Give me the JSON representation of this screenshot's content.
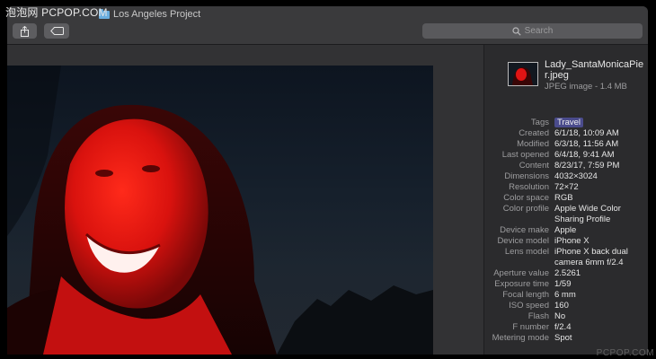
{
  "watermark": "泡泡网 PCPOP.COM",
  "window": {
    "title": "Los Angeles Project"
  },
  "toolbar": {
    "share_icon": "share-icon",
    "tag_icon": "tag-icon"
  },
  "search": {
    "placeholder": "Search",
    "icon": "magnifier-icon"
  },
  "file": {
    "name": "Lady_SantaMonicaPier.jpeg",
    "kind": "JPEG image - 1.4 MB"
  },
  "info": {
    "tags": {
      "label": "Tags",
      "value": "Travel",
      "color": "#4a4b8c"
    },
    "created": {
      "label": "Created",
      "value": "6/1/18, 10:09 AM"
    },
    "modified": {
      "label": "Modified",
      "value": "6/3/18, 11:56 AM"
    },
    "last_opened": {
      "label": "Last opened",
      "value": "6/4/18, 9:41 AM"
    },
    "content": {
      "label": "Content",
      "value": "8/23/17, 7:59 PM"
    },
    "dimensions": {
      "label": "Dimensions",
      "value": "4032×3024"
    },
    "resolution": {
      "label": "Resolution",
      "value": "72×72"
    },
    "color_space": {
      "label": "Color space",
      "value": "RGB"
    },
    "color_profile": {
      "label": "Color profile",
      "value": "Apple Wide Color Sharing Profile"
    },
    "device_make": {
      "label": "Device make",
      "value": "Apple"
    },
    "device_model": {
      "label": "Device model",
      "value": "iPhone X"
    },
    "lens_model": {
      "label": "Lens model",
      "value": "iPhone X back dual camera 6mm f/2.4"
    },
    "aperture_value": {
      "label": "Aperture value",
      "value": "2.5261"
    },
    "exposure_time": {
      "label": "Exposure time",
      "value": "1/59"
    },
    "focal_length": {
      "label": "Focal length",
      "value": "6 mm"
    },
    "iso_speed": {
      "label": "ISO speed",
      "value": "160"
    },
    "flash": {
      "label": "Flash",
      "value": "No"
    },
    "f_number": {
      "label": "F number",
      "value": "f/2.4"
    },
    "metering_mode": {
      "label": "Metering mode",
      "value": "Spot"
    }
  },
  "corner_watermark": "PCPOP.COM",
  "colors": {
    "window_bg": "#2b2b2d",
    "titlebar_bg": "#3a3a3c",
    "tag_accent": "#4a4b8c",
    "photo_red": "#e01414"
  }
}
